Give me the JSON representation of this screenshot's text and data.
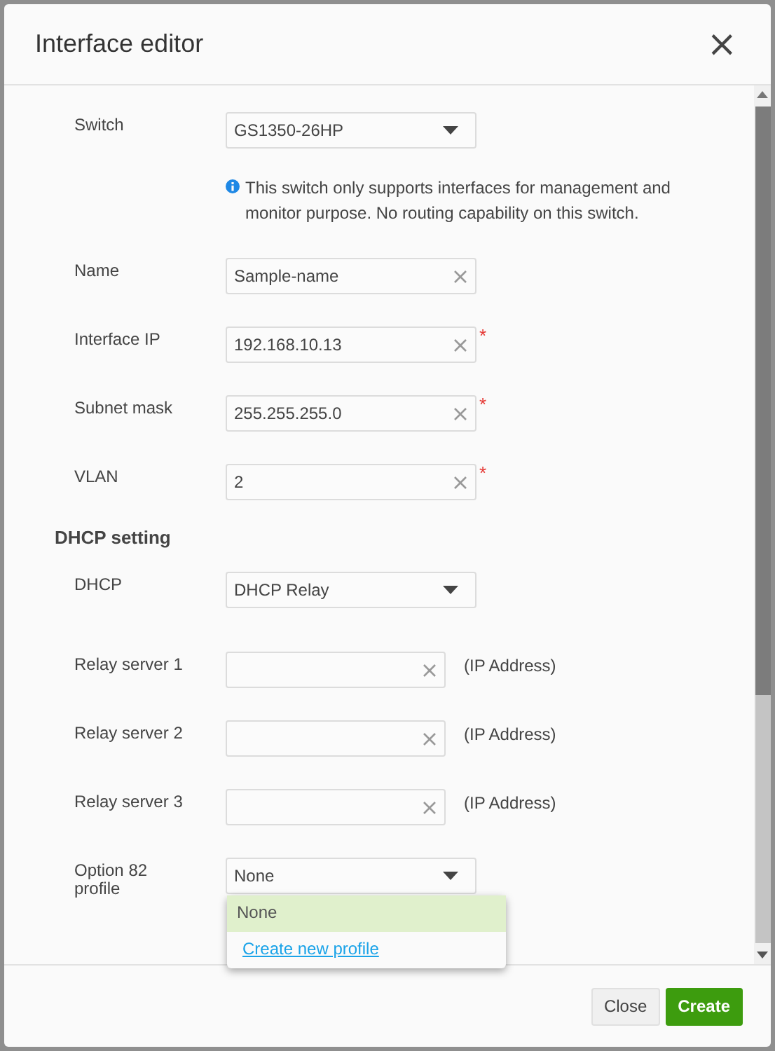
{
  "dialog": {
    "title": "Interface editor",
    "close": "×"
  },
  "fields": [
    {
      "kind": "select",
      "label": "Switch",
      "value": "GS1350-26HP",
      "note": "This switch only supports interfaces for management and monitor purpose. No routing capability on this switch."
    },
    {
      "kind": "text",
      "label": "Name",
      "value": "Sample-name"
    },
    {
      "kind": "text",
      "label": "Interface IP",
      "value": "192.168.10.13",
      "required_mark": "*"
    },
    {
      "kind": "text",
      "label": "Subnet mask",
      "value": "255.255.255.0",
      "required_mark": "*"
    },
    {
      "kind": "text",
      "label": "VLAN",
      "value": "2",
      "required_mark": "*"
    }
  ],
  "dhcp_setting": {
    "title": "DHCP setting",
    "fields": [
      {
        "kind": "select",
        "label": "DHCP",
        "value": "DHCP Relay"
      },
      {
        "kind": "text",
        "label": "Relay server 1",
        "suffix": "(IP Address)"
      },
      {
        "kind": "text",
        "label": "Relay server 2",
        "suffix": "(IP Address)"
      },
      {
        "kind": "text",
        "label": "Relay server 3",
        "suffix": "(IP Address)"
      },
      {
        "kind": "select",
        "label": "Option 82 profile",
        "value": "None",
        "expanded": true,
        "options": [
          {
            "kind": "option",
            "label": "None",
            "selected": true
          },
          {
            "kind": "link",
            "label": "Create new profile",
            "selected": false
          }
        ]
      }
    ]
  },
  "buttons": [
    {
      "kind": "secondary",
      "label": "Close"
    },
    {
      "kind": "primary",
      "label": "Create"
    }
  ]
}
